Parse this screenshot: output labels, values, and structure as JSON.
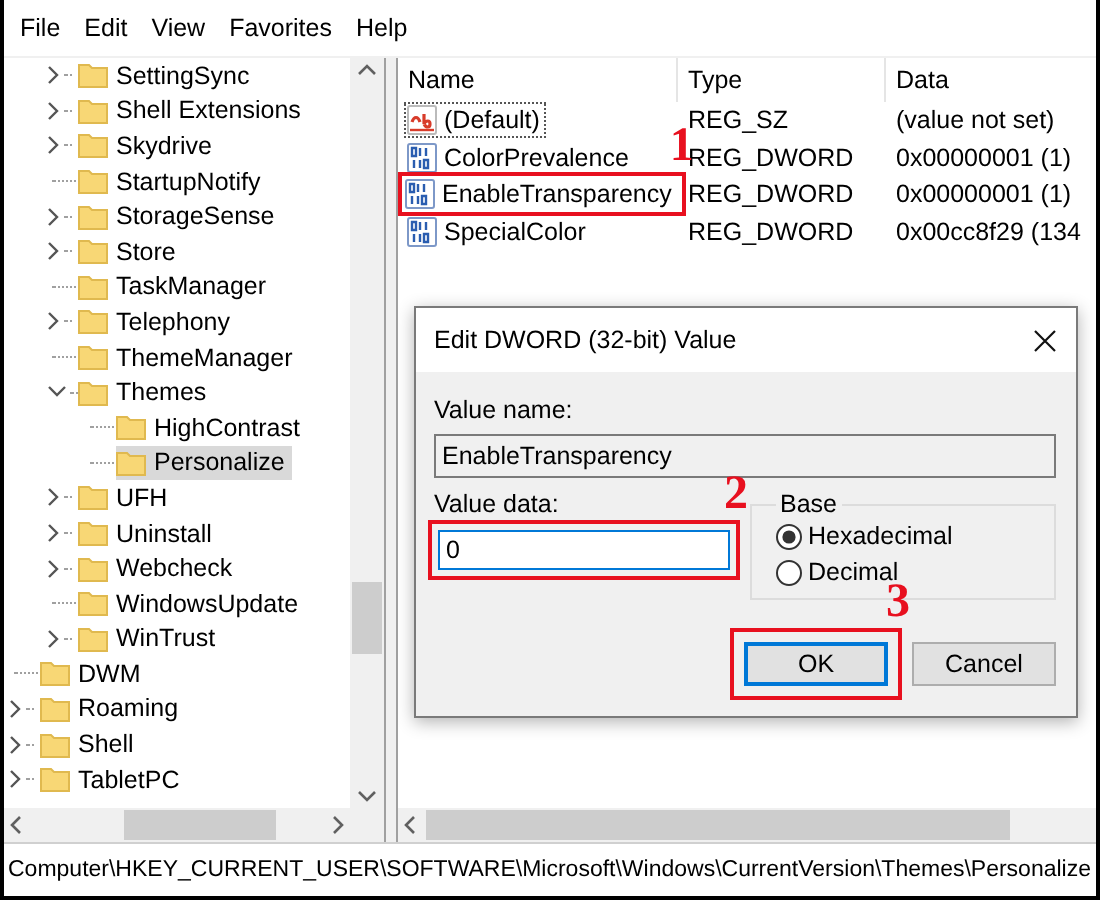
{
  "menu": [
    {
      "label": "File"
    },
    {
      "label": "Edit"
    },
    {
      "label": "View"
    },
    {
      "label": "Favorites"
    },
    {
      "label": "Help"
    }
  ],
  "tree": {
    "nested_items": [
      {
        "label": "SettingSync",
        "has_children": true,
        "expanded": false,
        "selected": false
      },
      {
        "label": "Shell Extensions",
        "has_children": true,
        "expanded": false,
        "selected": false
      },
      {
        "label": "Skydrive",
        "has_children": true,
        "expanded": false,
        "selected": false
      },
      {
        "label": "StartupNotify",
        "has_children": false,
        "selected": false
      },
      {
        "label": "StorageSense",
        "has_children": true,
        "expanded": false,
        "selected": false
      },
      {
        "label": "Store",
        "has_children": true,
        "expanded": false,
        "selected": false
      },
      {
        "label": "TaskManager",
        "has_children": false,
        "selected": false
      },
      {
        "label": "Telephony",
        "has_children": true,
        "expanded": false,
        "selected": false
      },
      {
        "label": "ThemeManager",
        "has_children": false,
        "selected": false
      },
      {
        "label": "Themes",
        "has_children": true,
        "expanded": true,
        "selected": false,
        "children": [
          {
            "label": "HighContrast",
            "has_children": false,
            "selected": false
          },
          {
            "label": "Personalize",
            "has_children": false,
            "selected": true
          }
        ]
      },
      {
        "label": "UFH",
        "has_children": true,
        "expanded": false,
        "selected": false
      },
      {
        "label": "Uninstall",
        "has_children": true,
        "expanded": false,
        "selected": false
      },
      {
        "label": "Webcheck",
        "has_children": true,
        "expanded": false,
        "selected": false
      },
      {
        "label": "WindowsUpdate",
        "has_children": false,
        "selected": false
      },
      {
        "label": "WinTrust",
        "has_children": true,
        "expanded": false,
        "selected": false
      }
    ],
    "items": [
      {
        "label": "DWM",
        "has_children": false,
        "selected": false
      },
      {
        "label": "Roaming",
        "has_children": true,
        "expanded": false,
        "selected": false
      },
      {
        "label": "Shell",
        "has_children": true,
        "expanded": false,
        "selected": false
      },
      {
        "label": "TabletPC",
        "has_children": true,
        "expanded": false,
        "selected": false
      }
    ]
  },
  "values": {
    "columns": [
      "Name",
      "Type",
      "Data"
    ],
    "rows": [
      {
        "kind": "string",
        "name": "(Default)",
        "type": "REG_SZ",
        "data": "(value not set)",
        "focused": true
      },
      {
        "kind": "dword",
        "name": "ColorPrevalence",
        "type": "REG_DWORD",
        "data": "0x00000001 (1)",
        "focused": false
      },
      {
        "kind": "dword",
        "name": "EnableTransparency",
        "type": "REG_DWORD",
        "data": "0x00000001 (1)",
        "focused": false,
        "callout": "1"
      },
      {
        "kind": "dword",
        "name": "SpecialColor",
        "type": "REG_DWORD",
        "data": "0x00cc8f29 (134",
        "focused": false
      }
    ]
  },
  "dialog": {
    "title": "Edit DWORD (32-bit) Value",
    "name_label": "Value name:",
    "name_value": "EnableTransparency",
    "data_label": "Value data:",
    "data_value": "0",
    "data_callout": "2",
    "base": {
      "title": "Base",
      "options": [
        {
          "label": "Hexadecimal",
          "selected": true
        },
        {
          "label": "Decimal",
          "selected": false
        }
      ]
    },
    "buttons": [
      {
        "label": "OK",
        "default": true,
        "callout": "3"
      },
      {
        "label": "Cancel",
        "default": false
      }
    ]
  },
  "status_bar": "Computer\\HKEY_CURRENT_USER\\SOFTWARE\\Microsoft\\Windows\\CurrentVersion\\Themes\\Personalize"
}
